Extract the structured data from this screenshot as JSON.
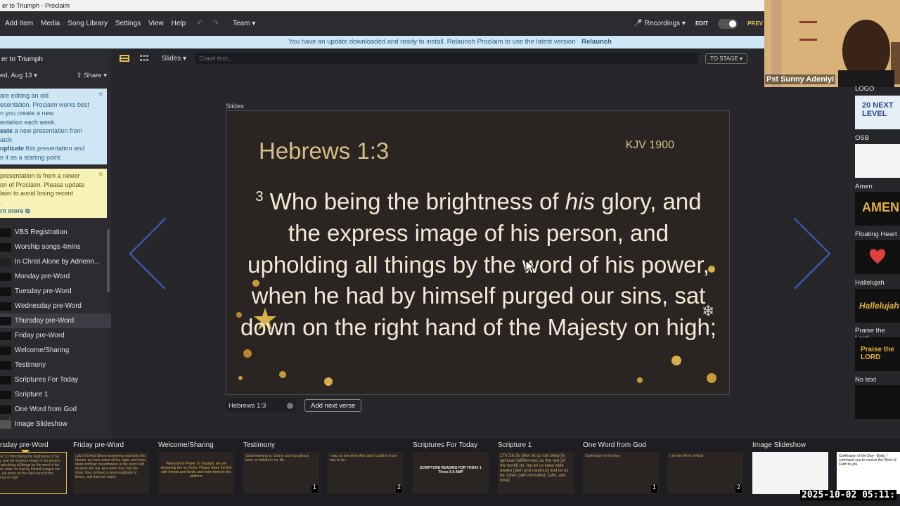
{
  "window": {
    "title": "er to Triumph - Proclaim"
  },
  "menu": {
    "items": [
      "Add Item",
      "Media",
      "Song Library",
      "Settings",
      "View",
      "Help"
    ],
    "team": "Team",
    "recordings": "Recordings",
    "edit": "EDIT",
    "preview": "PREV"
  },
  "update_bar": {
    "message": "You have an update downloaded and ready to install. Relaunch Proclaim to use the latest version",
    "action": "Relaunch"
  },
  "toolbar": {
    "slides_dropdown": "Slides",
    "crawl_placeholder": "Crawl text...",
    "to_stage": "TO STAGE"
  },
  "left_panel": {
    "presentation_title": "er to Triumph",
    "date": "ed, Aug 13",
    "share": "Share",
    "note_blue": {
      "line1": "are editing an old",
      "line2": "esentation. Proclaim works best",
      "line3": "n you create a new",
      "line4": "entation each week.",
      "create_bold": "eate",
      "create_rest": " a new presentation from",
      "create_rest2": "atch",
      "duplicate_bold": "uplicate",
      "duplicate_rest": " this presentation and",
      "duplicate_rest2": "e it as a starting point"
    },
    "note_yellow": {
      "line1": "presentation is from a newer",
      "line2": "on of Proclaim. Please update",
      "line3": "laim to avoid losing recent",
      "line4": ".",
      "learn_more": "rn more"
    },
    "items": [
      "VBS Registration",
      "Worship songs  4mins",
      "In Christ Alone  by Adrienn...",
      "Monday pre-Word",
      "Tuesday pre-Word",
      "Wednesday pre-Word",
      "Thursday pre-Word",
      "Friday pre-Word",
      "Welcome/Sharing",
      "Testimony",
      "Scriptures For Today",
      "Scripture 1",
      "One Word from God",
      "Image Slideshow"
    ]
  },
  "slide": {
    "section_label": "Slides",
    "title": "Hebrews 1:3",
    "version": "KJV 1900",
    "verse_number": "3",
    "verse_text_1": " Who being the brightness of ",
    "verse_text_his": "his",
    "verse_text_2": " glory, and the express image of his person, and upholding all things by the word of his power, when he had by himself purged our sins, sat down on the right hand of the Majesty on high;",
    "reference_field": "Hebrews 1:3",
    "add_next_verse": "Add next verse"
  },
  "right_panel": {
    "webcam_name": "Pst Sunny Adeniyi",
    "items": [
      {
        "label": "LOGO",
        "thumb": "20 NEXT LEVEL"
      },
      {
        "label": "OSB",
        "thumb": ""
      },
      {
        "label": "Amen",
        "thumb": "AMEN"
      },
      {
        "label": "Floating Heart",
        "thumb": ""
      },
      {
        "label": "Hallelujah",
        "thumb": "Hallelujah"
      },
      {
        "label": "Praise the Lord",
        "thumb": "Praise the LORD"
      },
      {
        "label": "No text",
        "thumb": ""
      }
    ]
  },
  "strip": {
    "labels": [
      "rsday pre-Word",
      "Friday pre-Word",
      "Welcome/Sharing",
      "Testimony",
      "Scriptures For Today",
      "Scripture 1",
      "One Word from God",
      "Image Slideshow"
    ],
    "thumbs": [
      "brews 1:3  Who being the brightness of his glory, and the express image of his person, and upholding all things by the word of his power, when he had by himself purged our sins, sat down on the right hand of the Majesty on high",
      "Luke 5:6  And Simon answering said unto him, Master, we have toiled all the night, and have taken nothing: nevertheless at thy word I will let down the net. And when they had this done, they inclosed a great multitude of fishes, and their net brake.",
      "Welcome to Power To Triumph, we are streaming live on Zoom. Please share the link with friends and family and invite them to this platform",
      "Good morning to. God is and has always been so faithful in my life.",
      "I was so low when Alex and I couldn't know why to do.",
      "SCRIPTURE READING FOR TODAY  1 Thess 5:6 AMP",
      "1Th 5:6  So then let us not sleep [in spiritual indifference] as the rest [of the world] do, but let us keep wide awake [alert and cautious] and let us be sober [self-controlled, calm, and wise].",
      "Confession of the Day",
      "I am the Word of God",
      "",
      "Confession of the Day-- Body, I command you to receive the Word of Faith to you."
    ],
    "badges": [
      "1",
      "2",
      "1",
      "2"
    ]
  },
  "timestamp": "2025-10-02 05:11:"
}
